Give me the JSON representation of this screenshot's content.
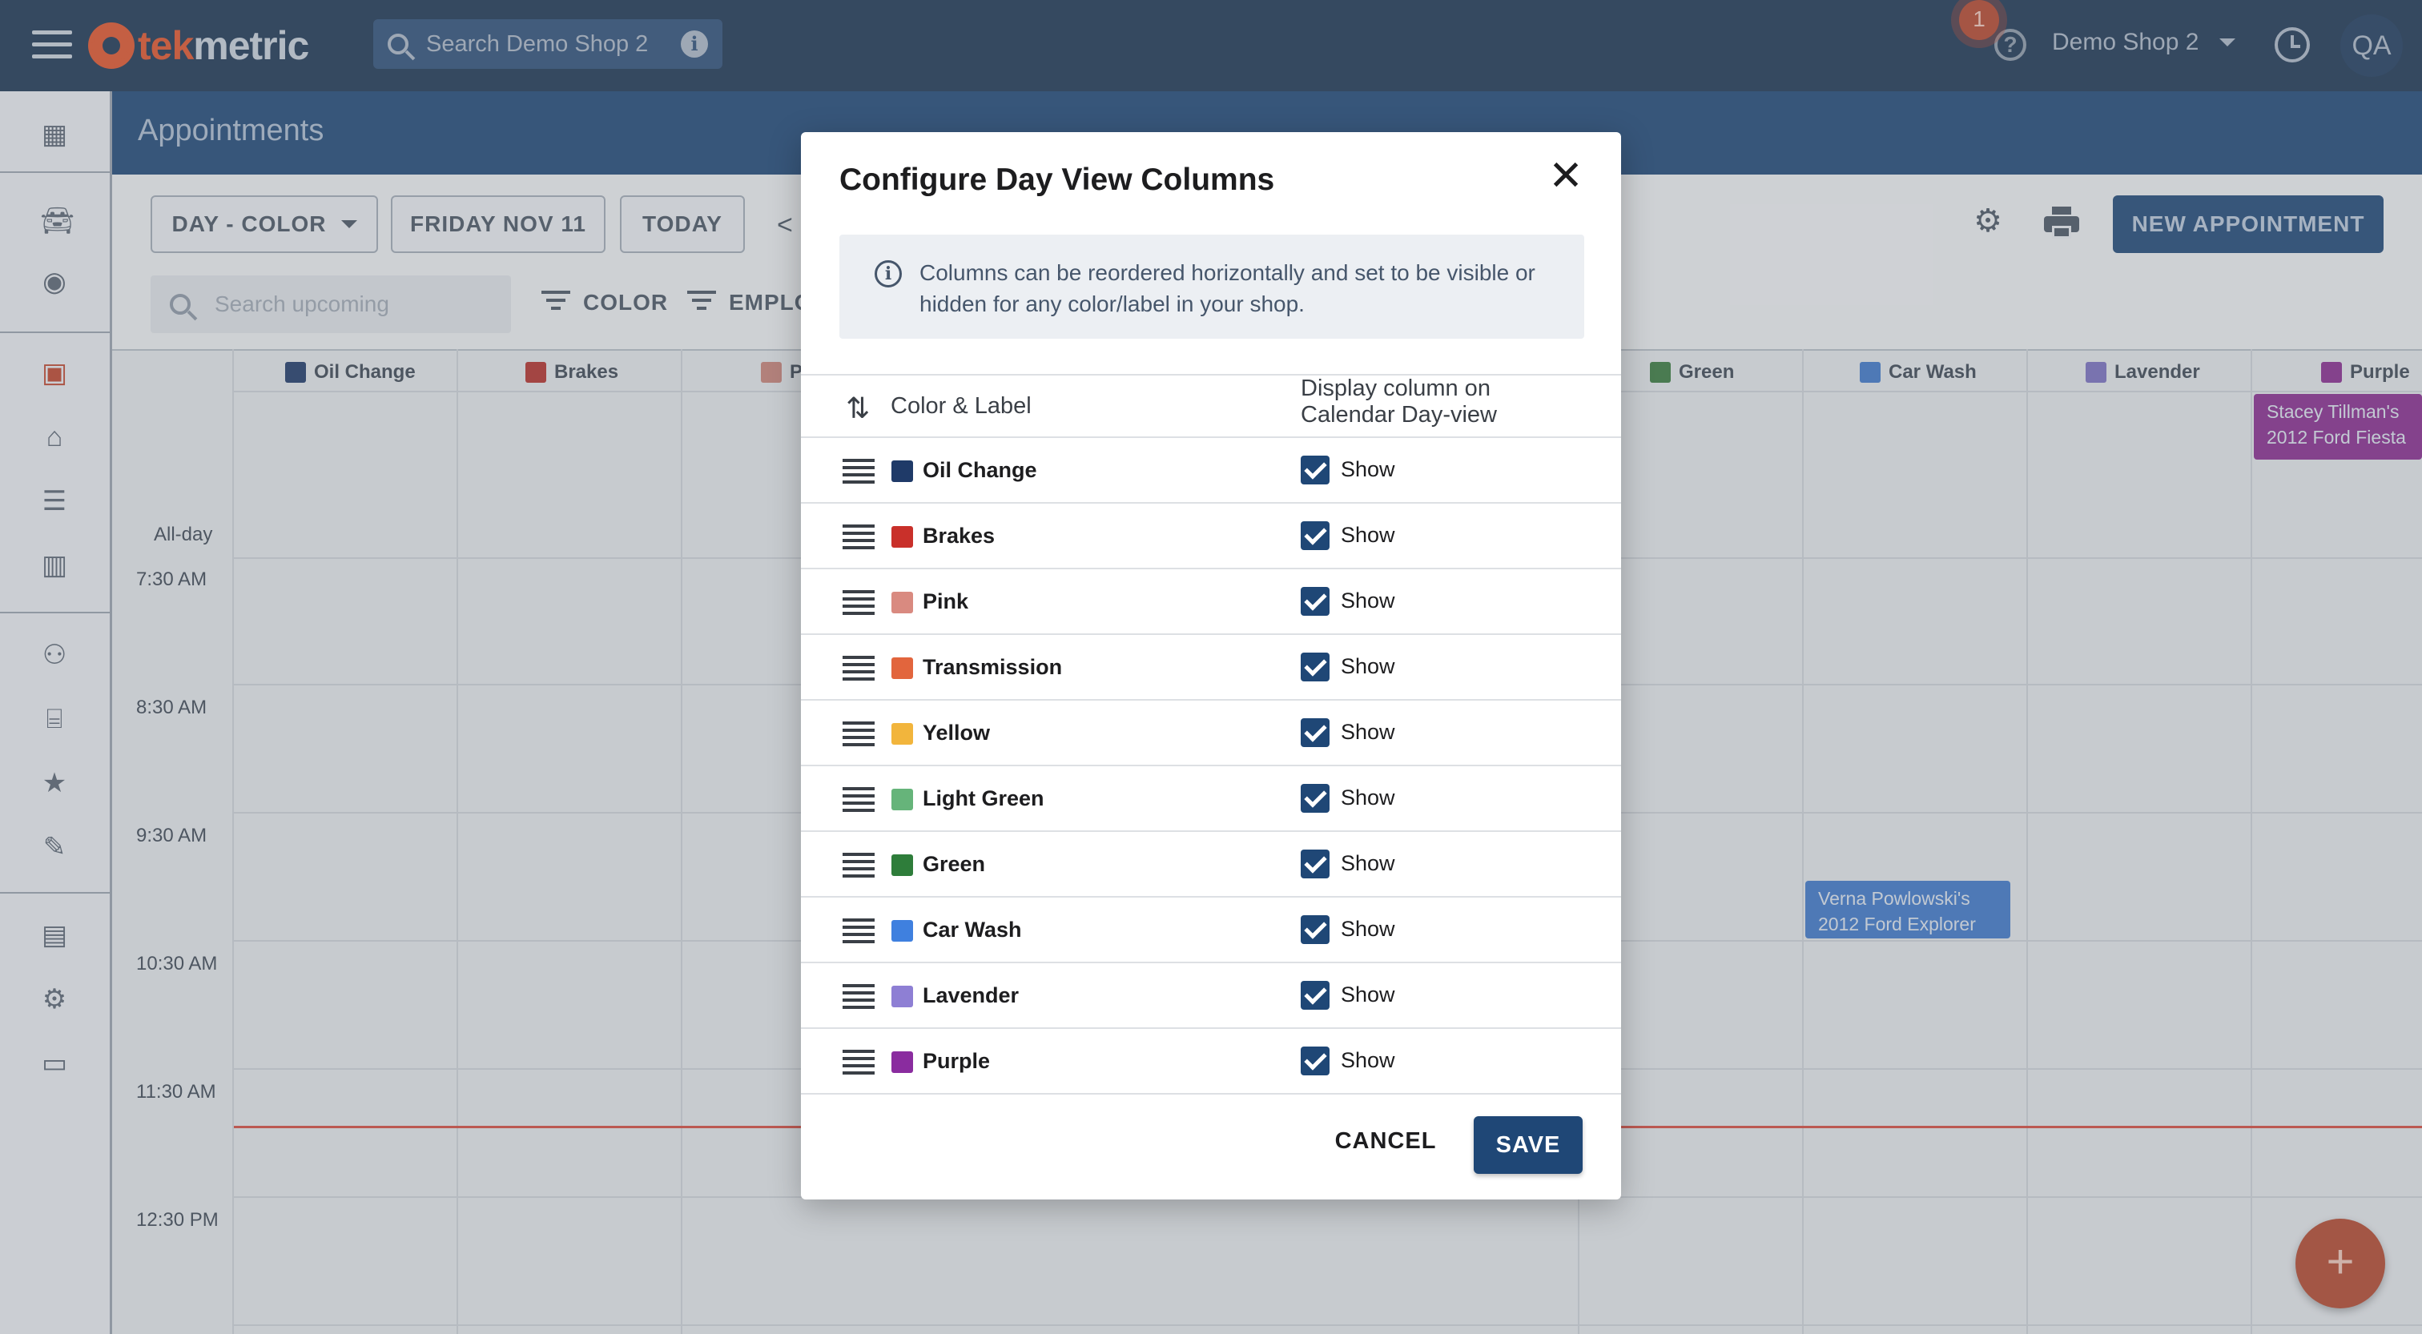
{
  "topbar": {
    "logo_tek": "tek",
    "logo_metric": "metric",
    "search_placeholder": "Search Demo Shop 2",
    "notification_count": "1",
    "shop_name": "Demo Shop 2",
    "user_initials": "QA"
  },
  "page": {
    "title": "Appointments"
  },
  "toolbar": {
    "view_label": "DAY - COLOR",
    "date_label": "FRIDAY NOV 11",
    "today_label": "TODAY",
    "prev_label": "<",
    "search_placeholder": "Search upcoming",
    "filter_color": "COLOR",
    "filter_employee": "EMPLO",
    "new_appointment": "NEW APPOINTMENT"
  },
  "calendar": {
    "allday_label": "All-day",
    "columns": [
      {
        "label": "Oil Change",
        "color": "#1f3a68"
      },
      {
        "label": "Brakes",
        "color": "#b5302a"
      },
      {
        "label": "P",
        "color": "#c98378"
      },
      {
        "label": "Green",
        "color": "#3a7a3e"
      },
      {
        "label": "Car Wash",
        "color": "#3f78c9"
      },
      {
        "label": "Lavender",
        "color": "#7a6fbf"
      },
      {
        "label": "Purple",
        "color": "#8a2c8f"
      }
    ],
    "times": [
      "7:30 AM",
      "8:30 AM",
      "9:30 AM",
      "10:30 AM",
      "11:30 AM",
      "12:30 PM"
    ],
    "events": [
      {
        "line1": "Stacey Tillman's",
        "line2": "2012 Ford Fiesta",
        "color": "#8a2c8f"
      },
      {
        "line1": "Verna Powlowski's",
        "line2": "2012 Ford Explorer",
        "color": "#3f78c9"
      }
    ]
  },
  "modal": {
    "title": "Configure Day View Columns",
    "info": "Columns can be reordered horizontally and set to be visible or hidden for any color/label in your shop.",
    "header_label": "Color & Label",
    "header_display_1": "Display column on",
    "header_display_2": "Calendar Day-view",
    "rows": [
      {
        "label": "Oil Change",
        "color": "#1f3a68",
        "show": "Show"
      },
      {
        "label": "Brakes",
        "color": "#c9302a",
        "show": "Show"
      },
      {
        "label": "Pink",
        "color": "#d98a80",
        "show": "Show"
      },
      {
        "label": "Transmission",
        "color": "#e2653d",
        "show": "Show"
      },
      {
        "label": "Yellow",
        "color": "#f2b53c",
        "show": "Show"
      },
      {
        "label": "Light Green",
        "color": "#66b47a",
        "show": "Show"
      },
      {
        "label": "Green",
        "color": "#2e7d3a",
        "show": "Show"
      },
      {
        "label": "Car Wash",
        "color": "#3f80df",
        "show": "Show"
      },
      {
        "label": "Lavender",
        "color": "#8e7fd4",
        "show": "Show"
      },
      {
        "label": "Purple",
        "color": "#8a2c9f",
        "show": "Show"
      }
    ],
    "cancel_label": "CANCEL",
    "save_label": "SAVE"
  },
  "fab_label": "+"
}
